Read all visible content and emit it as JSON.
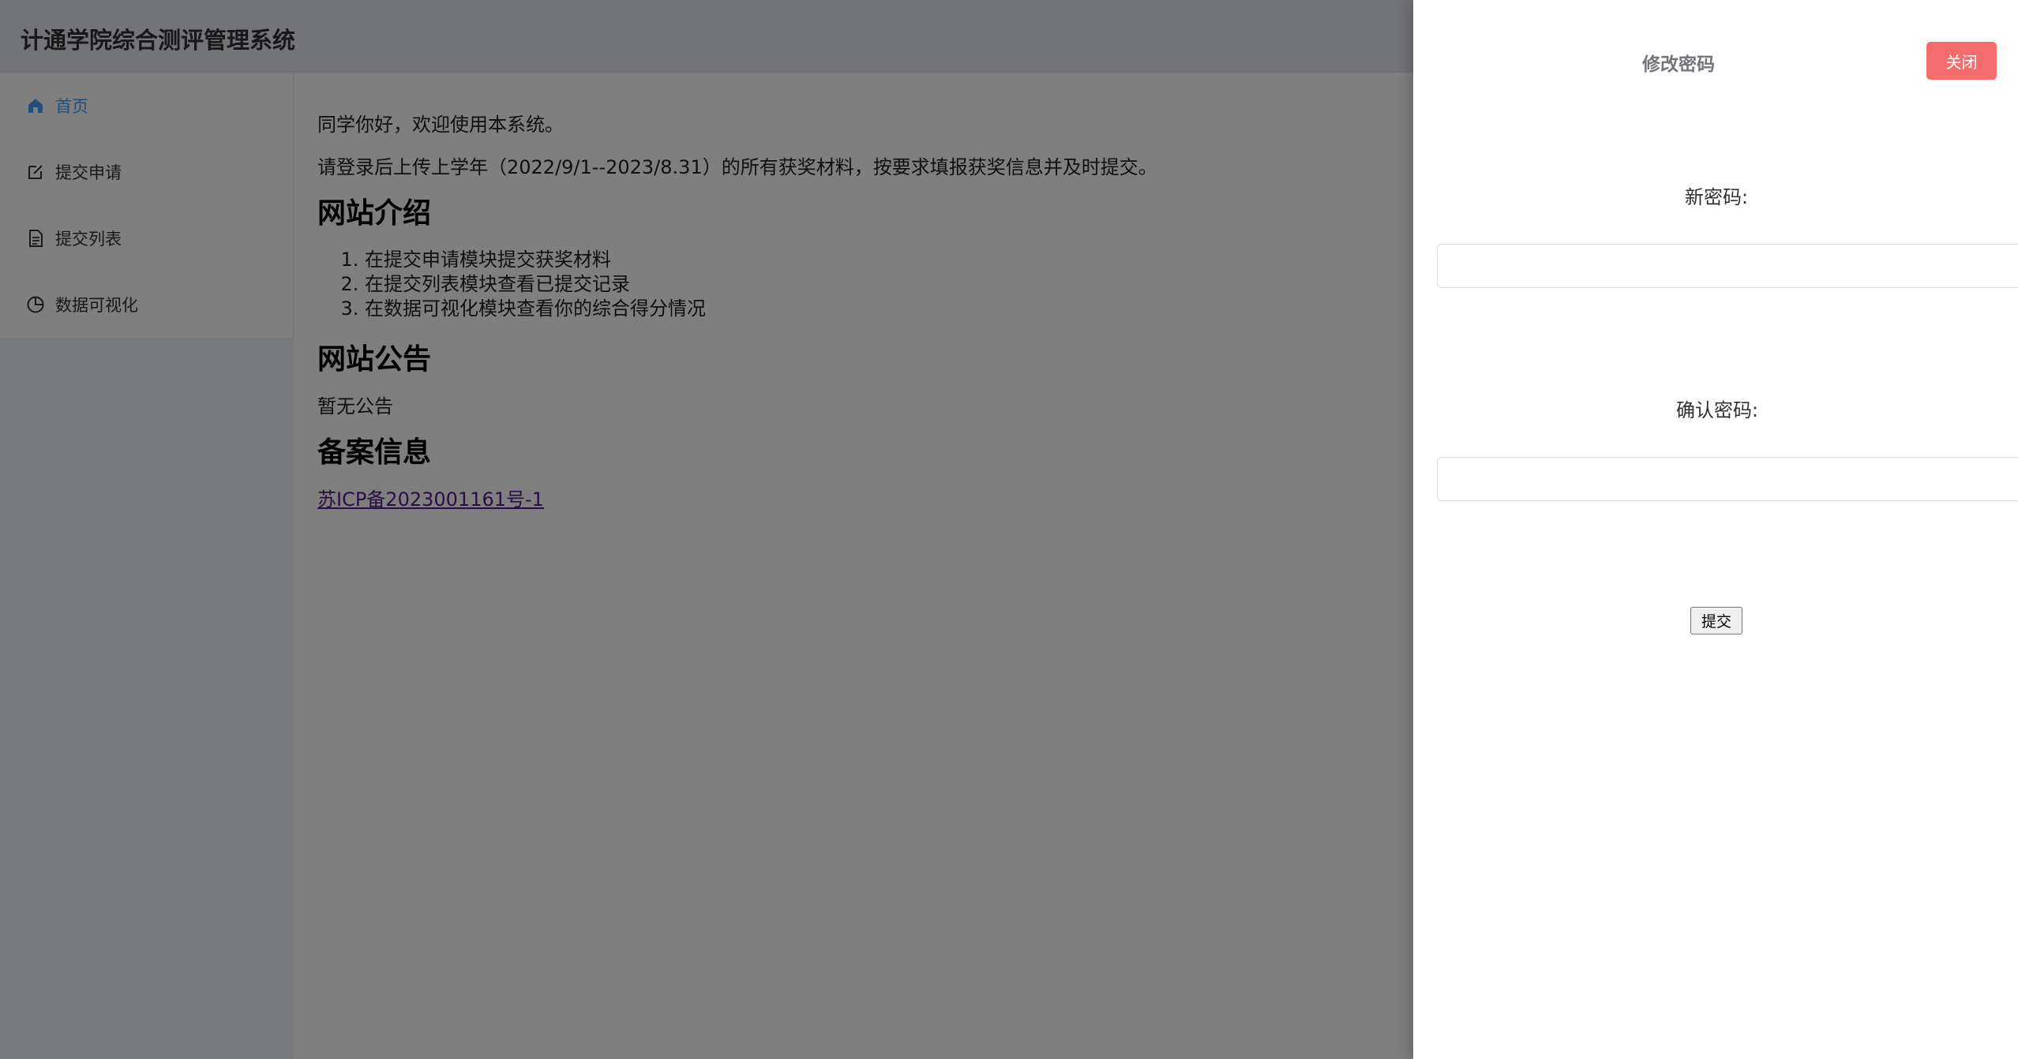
{
  "app": {
    "title": "计通学院综合测评管理系统"
  },
  "sidebar": {
    "items": [
      {
        "label": "首页",
        "icon": "home-icon",
        "active": true
      },
      {
        "label": "提交申请",
        "icon": "edit-icon",
        "active": false
      },
      {
        "label": "提交列表",
        "icon": "document-icon",
        "active": false
      },
      {
        "label": "数据可视化",
        "icon": "pie-chart-icon",
        "active": false
      }
    ]
  },
  "main": {
    "greeting": "同学你好，欢迎使用本系统。",
    "instruction": "请登录后上传上学年（2022/9/1--2023/8.31）的所有获奖材料，按要求填报获奖信息并及时提交。",
    "intro_heading": "网站介绍",
    "intro_items": [
      "在提交申请模块提交获奖材料",
      "在提交列表模块查看已提交记录",
      "在数据可视化模块查看你的综合得分情况"
    ],
    "notice_heading": "网站公告",
    "notice_text": "暂无公告",
    "record_heading": "备案信息",
    "record_link": "苏ICP备2023001161号-1"
  },
  "drawer": {
    "title": "修改密码",
    "close_label": "关闭",
    "new_password_label": "新密码:",
    "new_password_value": "",
    "confirm_password_label": "确认密码:",
    "confirm_password_value": "",
    "submit_label": "提交"
  },
  "colors": {
    "accent": "#409eff",
    "danger": "#f56c6c",
    "overlay": "rgba(0,0,0,0.5)"
  }
}
